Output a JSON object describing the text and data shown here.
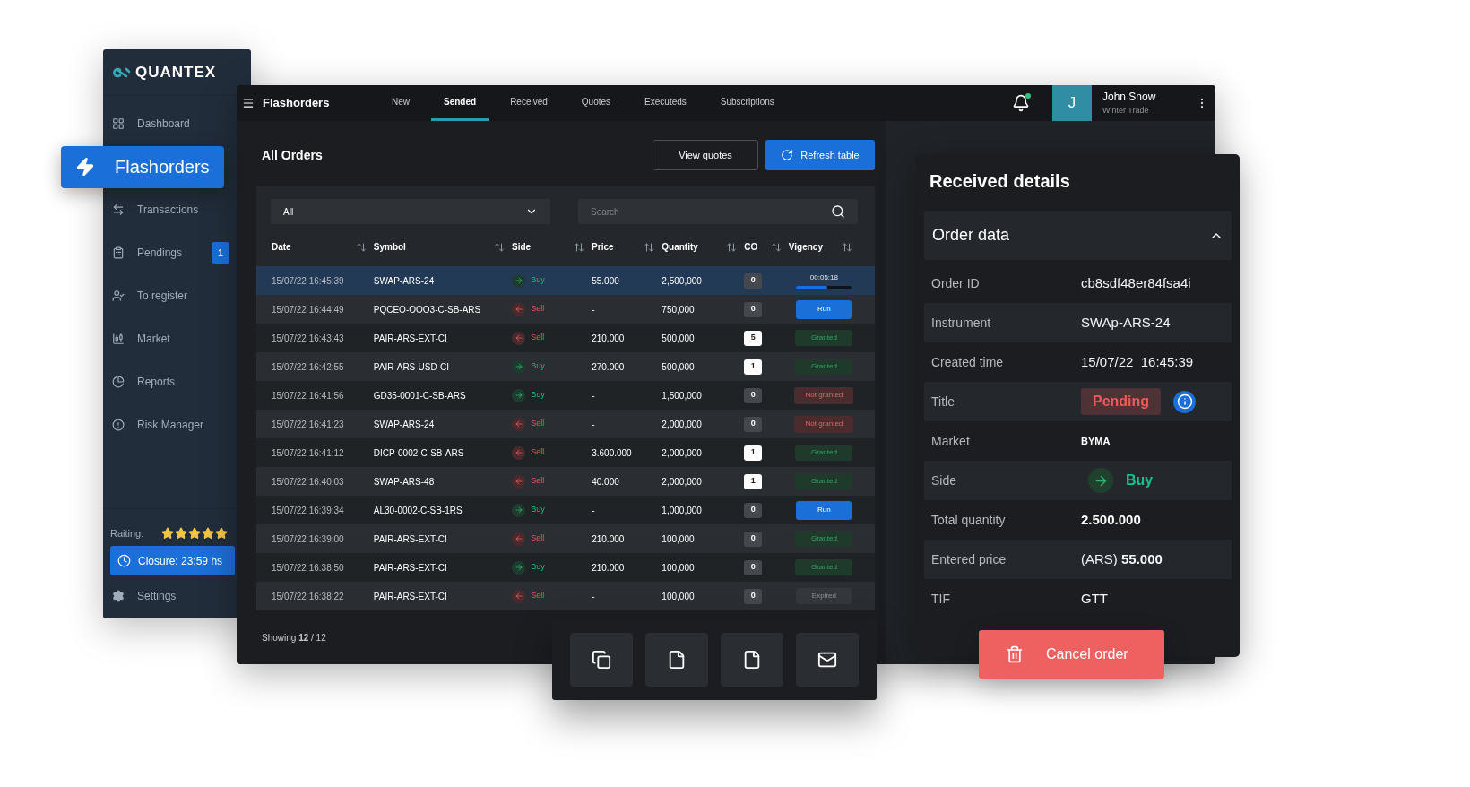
{
  "sidebar": {
    "logo": "QUANTEX",
    "items": [
      {
        "label": "Dashboard",
        "selected": false
      },
      {
        "label": "Flashorders",
        "selected": true
      },
      {
        "label": "Transactions",
        "selected": false
      },
      {
        "label": "Pendings",
        "selected": false,
        "badge": "1"
      },
      {
        "label": "To register",
        "selected": false
      },
      {
        "label": "Market",
        "selected": false
      },
      {
        "label": "Reports",
        "selected": false
      },
      {
        "label": "Risk Manager",
        "selected": false
      }
    ],
    "rating_label": "Raiting:",
    "stars": 5,
    "closure": "Closure: 23:59 hs",
    "settings": "Settings"
  },
  "header": {
    "title": "Flashorders",
    "tabs": [
      {
        "label": "New",
        "selected": false
      },
      {
        "label": "Sended",
        "selected": true
      },
      {
        "label": "Received",
        "selected": false
      },
      {
        "label": "Quotes",
        "selected": false
      },
      {
        "label": "Executeds",
        "selected": false
      },
      {
        "label": "Subscriptions",
        "selected": false
      }
    ],
    "notifications": {
      "unread": true
    },
    "user": {
      "initial": "J",
      "name": "John Snow",
      "company": "Winter Trade"
    }
  },
  "orders": {
    "title": "All Orders",
    "buttons": [
      {
        "label": "View quotes",
        "primary": false
      },
      {
        "label": "Refresh table",
        "primary": true
      }
    ],
    "filter": {
      "value": "All"
    },
    "search": {
      "placeholder": "Search"
    },
    "columns": [
      "Date",
      "Symbol",
      "Side",
      "Price",
      "Quantity",
      "CO",
      "Vigency"
    ],
    "rows": [
      {
        "date": "15/07/22 16:45:39",
        "symbol": "SWAP-ARS-24",
        "side": {
          "kind": "buy",
          "label": "Buy"
        },
        "price": "55.000",
        "quantity": "2,500,000",
        "co": {
          "value": "0",
          "active": false
        },
        "vigency": {
          "kind": "timer",
          "label": "00:05:18",
          "level": 0.55
        },
        "selected": true
      },
      {
        "date": "15/07/22 16:44:49",
        "symbol": "PQCEO-OOO3-C-SB-ARS",
        "side": {
          "kind": "sell",
          "label": "Sell"
        },
        "price": "-",
        "quantity": "750,000",
        "co": {
          "value": "0",
          "active": false
        },
        "vigency": {
          "kind": "run",
          "label": "Run"
        },
        "selected": false
      },
      {
        "date": "15/07/22 16:43:43",
        "symbol": "PAIR-ARS-EXT-CI",
        "side": {
          "kind": "sell",
          "label": "Sell"
        },
        "price": "210.000",
        "quantity": "500,000",
        "co": {
          "value": "5",
          "active": true
        },
        "vigency": {
          "kind": "granted",
          "label": "Granted"
        },
        "selected": false
      },
      {
        "date": "15/07/22 16:42:55",
        "symbol": "PAIR-ARS-USD-CI",
        "side": {
          "kind": "buy",
          "label": "Buy"
        },
        "price": "270.000",
        "quantity": "500,000",
        "co": {
          "value": "1",
          "active": true
        },
        "vigency": {
          "kind": "granted",
          "label": "Granted"
        },
        "selected": false
      },
      {
        "date": "15/07/22 16:41:56",
        "symbol": "GD35-0001-C-SB-ARS",
        "side": {
          "kind": "buy",
          "label": "Buy"
        },
        "price": "-",
        "quantity": "1,500,000",
        "co": {
          "value": "0",
          "active": false
        },
        "vigency": {
          "kind": "denied",
          "label": "Not granted"
        },
        "selected": false
      },
      {
        "date": "15/07/22 16:41:23",
        "symbol": "SWAP-ARS-24",
        "side": {
          "kind": "sell",
          "label": "Sell"
        },
        "price": "-",
        "quantity": "2,000,000",
        "co": {
          "value": "0",
          "active": false
        },
        "vigency": {
          "kind": "denied",
          "label": "Not granted"
        },
        "selected": false
      },
      {
        "date": "15/07/22 16:41:12",
        "symbol": "DICP-0002-C-SB-ARS",
        "side": {
          "kind": "sell",
          "label": "Sell"
        },
        "price": "3.600.000",
        "quantity": "2,000,000",
        "co": {
          "value": "1",
          "active": true
        },
        "vigency": {
          "kind": "granted",
          "label": "Granted"
        },
        "selected": false
      },
      {
        "date": "15/07/22 16:40:03",
        "symbol": "SWAP-ARS-48",
        "side": {
          "kind": "sell",
          "label": "Sell"
        },
        "price": "40.000",
        "quantity": "2,000,000",
        "co": {
          "value": "1",
          "active": true
        },
        "vigency": {
          "kind": "granted",
          "label": "Granted"
        },
        "selected": false
      },
      {
        "date": "15/07/22 16:39:34",
        "symbol": "AL30-0002-C-SB-1RS",
        "side": {
          "kind": "buy",
          "label": "Buy"
        },
        "price": "-",
        "quantity": "1,000,000",
        "co": {
          "value": "0",
          "active": false
        },
        "vigency": {
          "kind": "run",
          "label": "Run"
        },
        "selected": false
      },
      {
        "date": "15/07/22 16:39:00",
        "symbol": "PAIR-ARS-EXT-CI",
        "side": {
          "kind": "sell",
          "label": "Sell"
        },
        "price": "210.000",
        "quantity": "100,000",
        "co": {
          "value": "0",
          "active": false
        },
        "vigency": {
          "kind": "granted",
          "label": "Granted"
        },
        "selected": false
      },
      {
        "date": "15/07/22 16:38:50",
        "symbol": "PAIR-ARS-EXT-CI",
        "side": {
          "kind": "buy",
          "label": "Buy"
        },
        "price": "210.000",
        "quantity": "100,000",
        "co": {
          "value": "0",
          "active": false
        },
        "vigency": {
          "kind": "granted",
          "label": "Granted"
        },
        "selected": false
      },
      {
        "date": "15/07/22 16:38:22",
        "symbol": "PAIR-ARS-EXT-CI",
        "side": {
          "kind": "sell",
          "label": "Sell"
        },
        "price": "-",
        "quantity": "100,000",
        "co": {
          "value": "0",
          "active": false
        },
        "vigency": {
          "kind": "expired",
          "label": "Expired"
        },
        "selected": false
      }
    ],
    "showing": "Showing **12** / 12"
  },
  "details": {
    "title": "Received details",
    "section": {
      "title": "Order data",
      "expanded": true
    },
    "fields": [
      {
        "label": "Order ID",
        "kind": "text",
        "value": "cb8sdf48er84fsa4i"
      },
      {
        "label": "Instrument",
        "kind": "text",
        "value": "SWAp-ARS-24"
      },
      {
        "label": "Created time",
        "kind": "text",
        "value": "15/07/22  16:45:39"
      },
      {
        "label": "Title",
        "kind": "status",
        "value": "Pending"
      },
      {
        "label": "Market",
        "kind": "tag",
        "value": "BYMA"
      },
      {
        "label": "Side",
        "kind": "side",
        "value": "Buy"
      },
      {
        "label": "Total quantity",
        "kind": "strong",
        "value": "2.500.000"
      },
      {
        "label": "Entered price",
        "kind": "text",
        "value": "(ARS) **55.000**"
      },
      {
        "label": "TIF",
        "kind": "text",
        "value": "GTT"
      }
    ],
    "cancel": "Cancel order"
  }
}
